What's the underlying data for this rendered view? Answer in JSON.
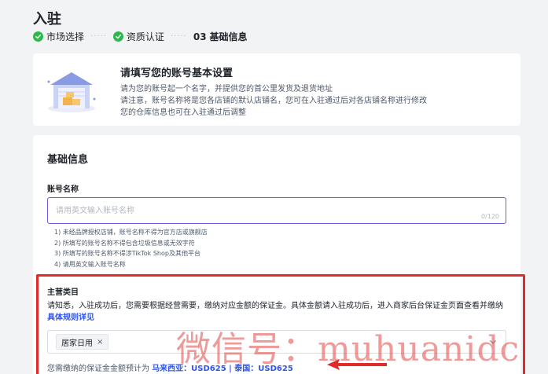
{
  "page": {
    "title": "入驻"
  },
  "steps": [
    {
      "label": "市场选择",
      "state": "done"
    },
    {
      "label": "资质认证",
      "state": "done"
    },
    {
      "number": "03",
      "label": "基础信息",
      "state": "current"
    }
  ],
  "intro": {
    "heading": "请填写您的账号基本设置",
    "lines": [
      "请为您的账号起一个名字，并提供您的首公里发货及退货地址",
      "请注意，账号名称将是您各店铺的默认店铺名，您可在入驻通过后对各店铺名称进行修改",
      "您的仓库信息也可在入驻通过后调整"
    ],
    "illustration_icon": "warehouse-icon"
  },
  "basic_info": {
    "section_title": "基础信息",
    "account_name": {
      "label": "账号名称",
      "value": "",
      "placeholder": "请用英文输入账号名称",
      "counter": "0/120"
    },
    "rules": [
      "1) 未经品牌授权店铺，账号名称不得为官方店或旗舰店",
      "2) 所填写的账号名称不得包含垃圾信息或无效字符",
      "3) 所填写的账号名称不得涉TikTok Shop及其他平台",
      "4) 请用英文输入账号名称"
    ]
  },
  "main_category": {
    "label": "主营类目",
    "notice": "请知悉，入驻成功后，您需要根据经营需要，缴纳对应金额的保证金。具体金额请入驻成功后，进入商家后台保证金页面查看并缴纳",
    "rules_link": "具体规则详见",
    "selected_tag": "居家日用",
    "tag_remove_icon": "close-icon",
    "dropdown_icon": "chevron-down-icon",
    "deposit_prefix": "您需缴纳的保证金金额预计为",
    "deposit_amount": "马来西亚：USD625 | 泰国：USD625"
  },
  "annotation": {
    "highlight_color": "#e02b2b",
    "arrow_icon": "arrow-left-icon"
  },
  "watermark": {
    "text": "微信号：muhuanidc"
  },
  "colors": {
    "accent": "#6b5be6",
    "link": "#2f54eb",
    "success": "#2db84d"
  }
}
